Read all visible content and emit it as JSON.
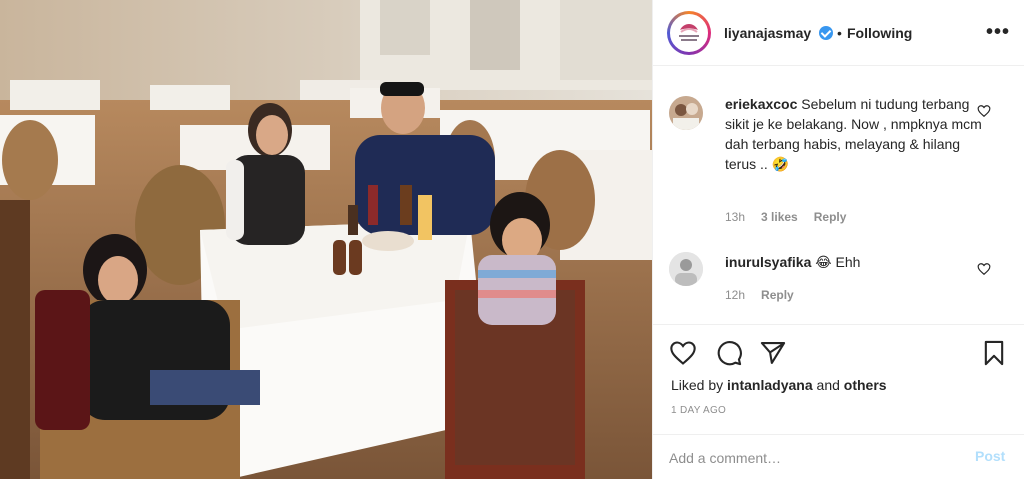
{
  "post": {
    "username": "liyanajasmay",
    "verified": true,
    "separator": "•",
    "follow_status": "Following",
    "more_label": "•••",
    "avatar_text": "LIYANA JASMAY"
  },
  "comments": [
    {
      "username": "eriekaxcoc",
      "text": "Sebelum ni tudung terbang sikit je ke belakang. Now , nmpknya mcm dah terbang habis, melayang & hilang terus .. 🤣",
      "time": "13h",
      "likes": "3 likes",
      "reply_label": "Reply"
    },
    {
      "username": "inurulsyafika",
      "text": "😂 Ehh",
      "time": "12h",
      "likes": "",
      "reply_label": "Reply"
    }
  ],
  "actions": {
    "icons": [
      "heart-icon",
      "comment-icon",
      "share-icon",
      "bookmark-icon"
    ],
    "liked_by_prefix": "Liked by",
    "liked_by_user": "intanladyana",
    "liked_by_and": "and",
    "liked_by_others": "others",
    "time_ago": "1 DAY AGO"
  },
  "add_comment": {
    "placeholder": "Add a comment…",
    "post_label": "Post"
  },
  "colors": {
    "accent_blue": "#3897f0",
    "post_disabled": "#b2dffc",
    "meta_gray": "#8e8e8e",
    "text": "#262626"
  }
}
